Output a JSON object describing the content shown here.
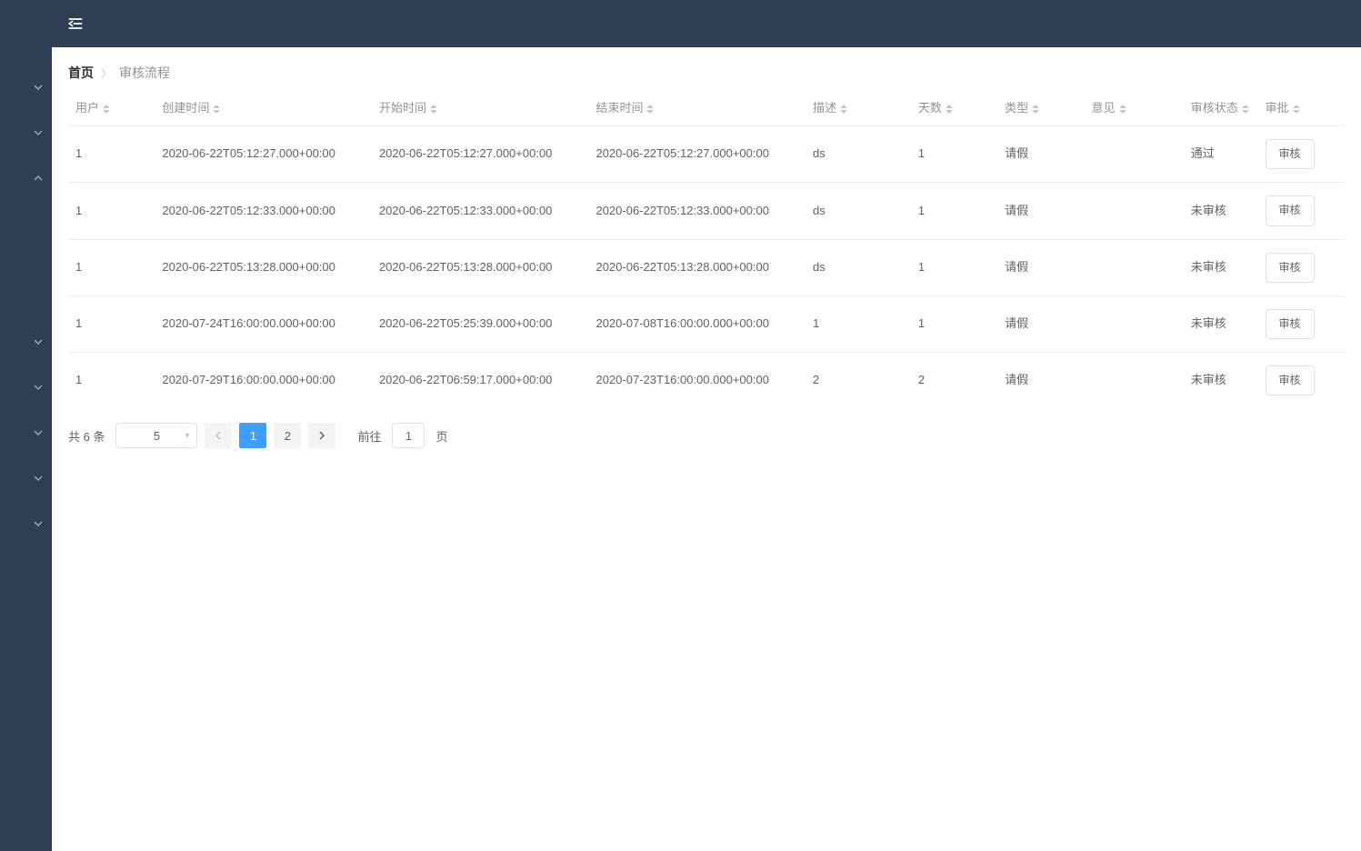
{
  "sidebar": {
    "items": [
      {
        "expanded": false
      },
      {
        "expanded": false
      },
      {
        "expanded": true
      },
      {
        "expanded": false
      },
      {
        "expanded": false
      },
      {
        "expanded": false
      },
      {
        "expanded": false
      },
      {
        "expanded": false
      }
    ]
  },
  "breadcrumb": {
    "home": "首页",
    "current": "审核流程"
  },
  "table": {
    "columns": {
      "user": "用户",
      "create_time": "创建时间",
      "start_time": "开始时间",
      "end_time": "结束时间",
      "desc": "描述",
      "days": "天数",
      "type": "类型",
      "opinion": "意见",
      "status": "审核状态",
      "approve": "审批"
    },
    "action_label": "审核",
    "rows": [
      {
        "user": "1",
        "create_time": "2020-06-22T05:12:27.000+00:00",
        "start_time": "2020-06-22T05:12:27.000+00:00",
        "end_time": "2020-06-22T05:12:27.000+00:00",
        "desc": "ds",
        "days": "1",
        "type": "请假",
        "opinion": "",
        "status": "通过"
      },
      {
        "user": "1",
        "create_time": "2020-06-22T05:12:33.000+00:00",
        "start_time": "2020-06-22T05:12:33.000+00:00",
        "end_time": "2020-06-22T05:12:33.000+00:00",
        "desc": "ds",
        "days": "1",
        "type": "请假",
        "opinion": "",
        "status": "未审核"
      },
      {
        "user": "1",
        "create_time": "2020-06-22T05:13:28.000+00:00",
        "start_time": "2020-06-22T05:13:28.000+00:00",
        "end_time": "2020-06-22T05:13:28.000+00:00",
        "desc": "ds",
        "days": "1",
        "type": "请假",
        "opinion": "",
        "status": "未审核"
      },
      {
        "user": "1",
        "create_time": "2020-07-24T16:00:00.000+00:00",
        "start_time": "2020-06-22T05:25:39.000+00:00",
        "end_time": "2020-07-08T16:00:00.000+00:00",
        "desc": "1",
        "days": "1",
        "type": "请假",
        "opinion": "",
        "status": "未审核"
      },
      {
        "user": "1",
        "create_time": "2020-07-29T16:00:00.000+00:00",
        "start_time": "2020-06-22T06:59:17.000+00:00",
        "end_time": "2020-07-23T16:00:00.000+00:00",
        "desc": "2",
        "days": "2",
        "type": "请假",
        "opinion": "",
        "status": "未审核"
      }
    ]
  },
  "pagination": {
    "total_text": "共 6 条",
    "page_size": "5",
    "pages": [
      "1",
      "2"
    ],
    "active_page": "1",
    "jump_label_prefix": "前往",
    "jump_value": "1",
    "jump_label_suffix": "页"
  }
}
